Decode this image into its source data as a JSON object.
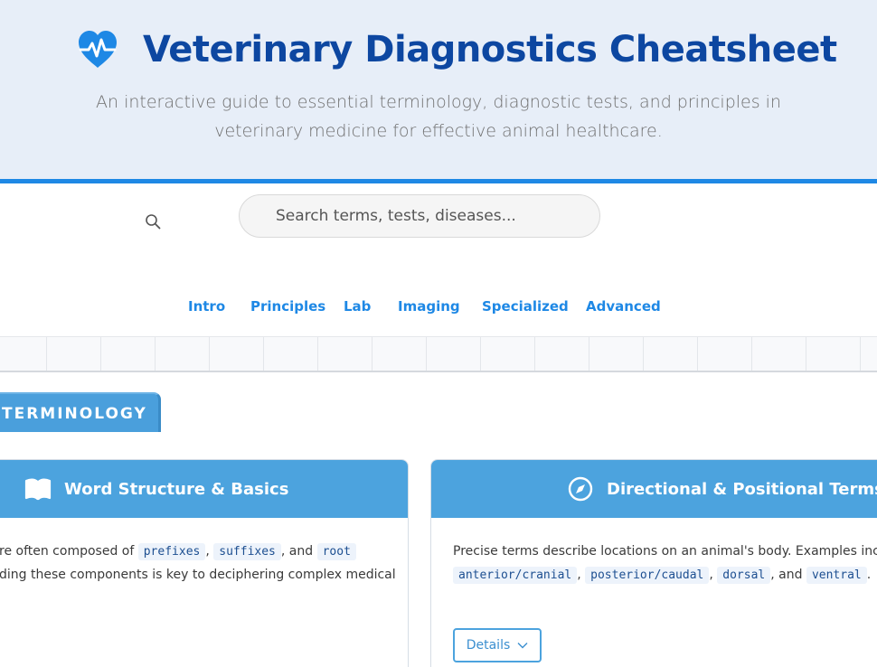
{
  "header": {
    "title": "Veterinary Diagnostics Cheatsheet",
    "subtitle": "An interactive guide to essential terminology, diagnostic tests, and principles in veterinary medicine for effective animal healthcare.",
    "logo_icon": "heartbeat-icon",
    "accent_color": "#1e88e5",
    "title_color": "#0d47a1"
  },
  "search": {
    "placeholder": "Search terms, tests, diseases...",
    "icon": "search-icon"
  },
  "nav": {
    "items": [
      {
        "label": "Intro"
      },
      {
        "label": "Principles"
      },
      {
        "label": "Lab"
      },
      {
        "label": "Imaging"
      },
      {
        "label": "Specialized"
      },
      {
        "label": "Advanced"
      }
    ]
  },
  "section": {
    "label": "TERMINOLOGY",
    "color": "#4a9fdc"
  },
  "cards": [
    {
      "title": "Word Structure & Basics",
      "icon": "book-icon",
      "line1_text": "re often composed of",
      "codes1": [
        "prefixes",
        "suffixes",
        "root"
      ],
      "sep1": ",",
      "and1": ", and",
      "line2_text": "ding these components is key to deciphering complex medical"
    },
    {
      "title": "Directional & Positional Terms",
      "icon": "compass-icon",
      "line1_text": "Precise terms describe locations on an animal's body. Examples include",
      "codes": [
        "anterior/cranial",
        "posterior/caudal",
        "dorsal",
        "ventral"
      ],
      "sep": ",",
      "and_text": ", and",
      "end": ".",
      "details_label": "Details",
      "details_icon": "chevron-down-icon"
    }
  ]
}
